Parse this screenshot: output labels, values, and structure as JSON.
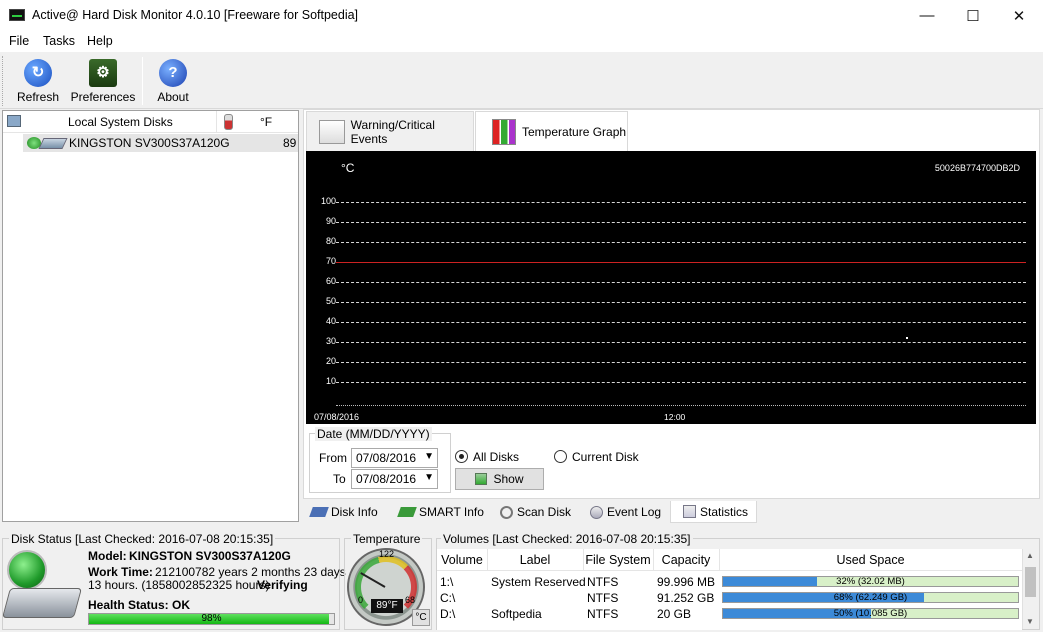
{
  "window": {
    "title": "Active@ Hard Disk Monitor 4.0.10 [Freeware for Softpedia]",
    "minimize": "—",
    "maximize": "☐",
    "close": "✕"
  },
  "menu": [
    "File",
    "Tasks",
    "Help"
  ],
  "toolbar": {
    "refresh": "Refresh",
    "preferences": "Preferences",
    "about": "About"
  },
  "disks": {
    "header": "Local System Disks",
    "unit": "°F",
    "rows": [
      {
        "name": "KINGSTON SV300S37A120G",
        "temp": "89"
      }
    ]
  },
  "tabs": {
    "events": "Warning/Critical Events",
    "graph": "Temperature Graph"
  },
  "graph": {
    "unit": "°C",
    "disk_id": "50026B774700DB2D",
    "y_labels": [
      "100",
      "90",
      "80",
      "70",
      "60",
      "50",
      "40",
      "30",
      "20",
      "10"
    ],
    "date_start": "07/08/2016",
    "time_mid": "12:00",
    "critical_threshold": 70,
    "critical_color": "#cc2222"
  },
  "date_filter": {
    "group": "Date (MM/DD/YYYY)",
    "from_label": "From",
    "from_value": "07/08/2016",
    "to_label": "To",
    "to_value": "07/08/2016",
    "all_disks": "All Disks",
    "current_disk": "Current Disk",
    "show": "Show"
  },
  "bottom_tabs": [
    "Disk Info",
    "SMART Info",
    "Scan Disk",
    "Event Log",
    "Statistics"
  ],
  "disk_status": {
    "title": "Disk Status [Last Checked: 2016-07-08 20:15:35]",
    "model_label": "Model:",
    "model": "KINGSTON SV300S37A120G",
    "work_label": "Work Time:",
    "work_value": "212100782 years 2 months 23 days",
    "work_value2": "13 hours. (1858002852325 hours)",
    "verifying": "Verifying",
    "health_label": "Health Status:",
    "health_value": "OK",
    "health_percent": "98%",
    "health_fraction": 0.98
  },
  "temperature": {
    "title": "Temperature",
    "max": "122",
    "low": "0",
    "mid": "68",
    "value": "89°F",
    "unit_btn": "°C"
  },
  "volumes": {
    "title": "Volumes [Last Checked: 2016-07-08 20:15:35]",
    "headers": [
      "Volume",
      "Label",
      "File System",
      "Capacity",
      "Used Space"
    ],
    "rows": [
      {
        "volume": "1:\\",
        "label": "System Reserved",
        "fs": "NTFS",
        "capacity": "99.996 MB",
        "used": "32% (32.02 MB)",
        "fraction": 0.32
      },
      {
        "volume": "C:\\",
        "label": "",
        "fs": "NTFS",
        "capacity": "91.252 GB",
        "used": "68% (62.249 GB)",
        "fraction": 0.68
      },
      {
        "volume": "D:\\",
        "label": "Softpedia",
        "fs": "NTFS",
        "capacity": "20 GB",
        "used": "50% (10.085 GB)",
        "fraction": 0.5
      }
    ]
  }
}
